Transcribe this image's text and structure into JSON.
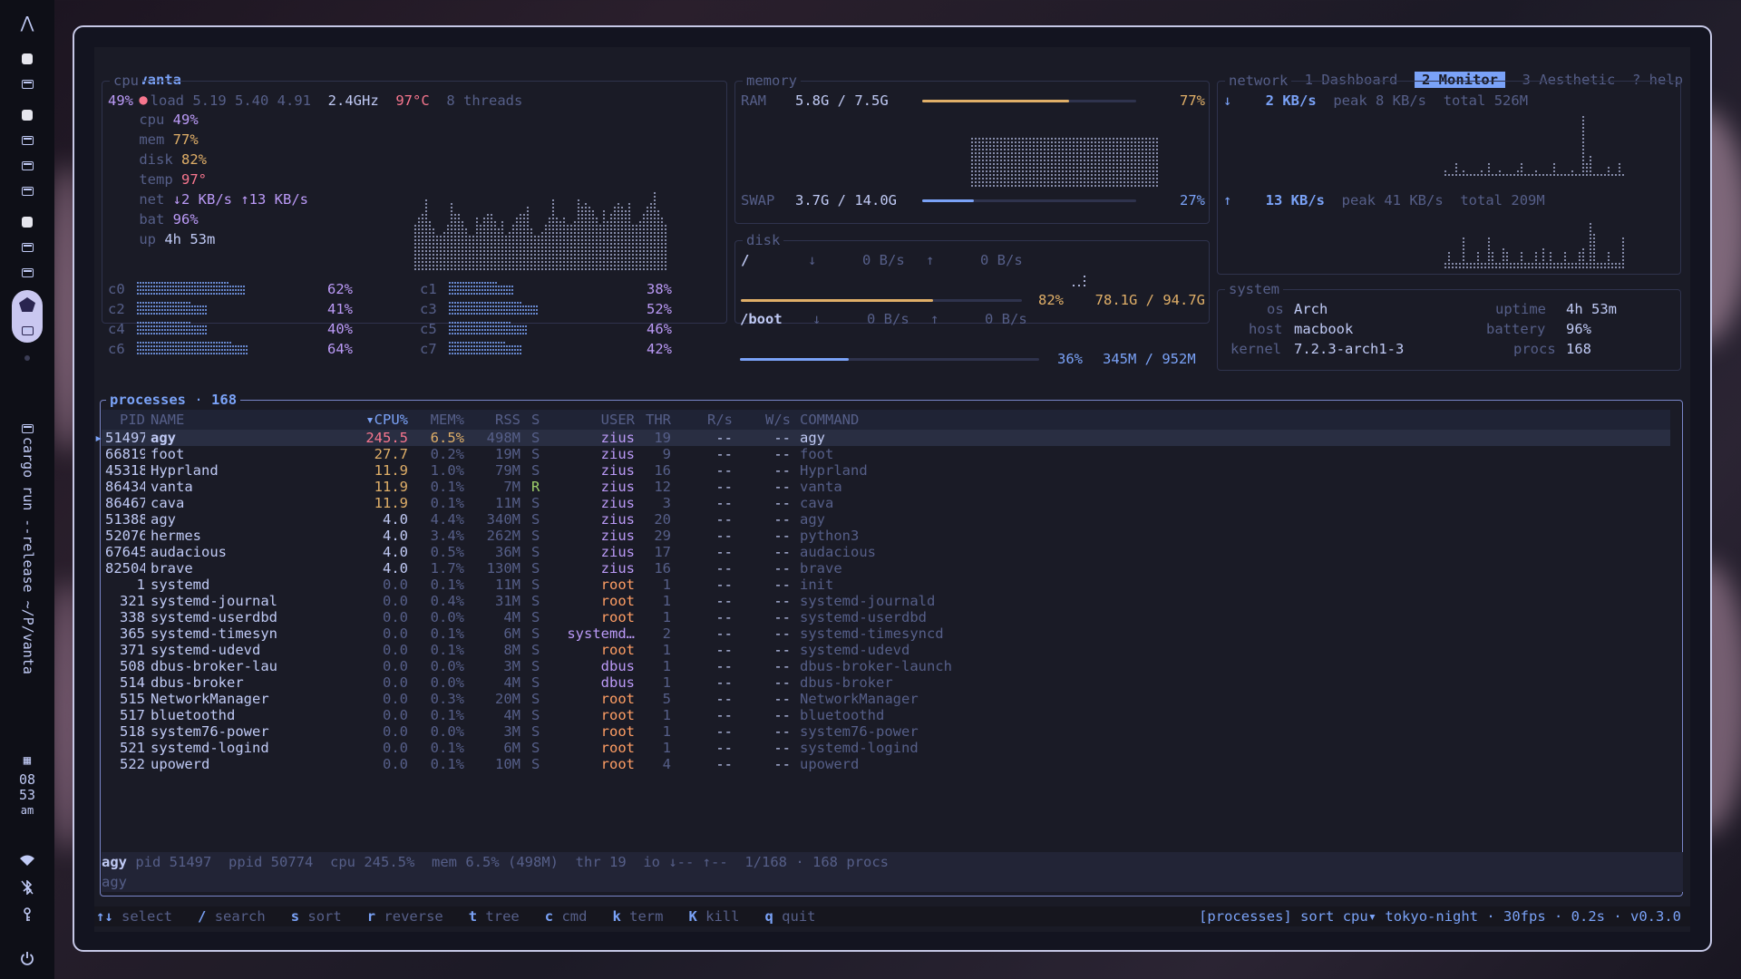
{
  "sidebar": {
    "clock": {
      "hour": "08",
      "minute": "53",
      "ampm": "am"
    },
    "workspace_title": "cargo run --release ~/P/vanta"
  },
  "topbar": {
    "app": "vanta",
    "dot_color": "#f7768e",
    "cpu_label": "cpu",
    "cpu": "49%",
    "mem_label": "mem",
    "mem": "77%",
    "disk_label": "disk",
    "disk": "82%",
    "temp_label": "temp",
    "temp": "97°",
    "net_label": "net",
    "net_down": "↓2 KB/s",
    "net_up": "↑13 KB/s",
    "bat_label": "bat",
    "bat": "96%",
    "up_label": "up",
    "up": "4h 53m",
    "tabs": [
      {
        "label": "1 Dashboard"
      },
      {
        "label": "2 Monitor",
        "active": true
      },
      {
        "label": "3 Aesthetic"
      },
      {
        "label": "? help"
      }
    ]
  },
  "cpu": {
    "title": "cpu",
    "usage": "49%",
    "load_label": "load",
    "load": "5.19 5.40 4.91",
    "freq": "2.4GHz",
    "temp": "97°C",
    "threads": "8 threads",
    "cores": [
      {
        "name": "c0",
        "value": "62%",
        "level": 0.62
      },
      {
        "name": "c1",
        "value": "38%",
        "level": 0.38
      },
      {
        "name": "c2",
        "value": "41%",
        "level": 0.41
      },
      {
        "name": "c3",
        "value": "52%",
        "level": 0.52
      },
      {
        "name": "c4",
        "value": "40%",
        "level": 0.4
      },
      {
        "name": "c5",
        "value": "46%",
        "level": 0.46
      },
      {
        "name": "c6",
        "value": "64%",
        "level": 0.64
      },
      {
        "name": "c7",
        "value": "42%",
        "level": 0.42
      }
    ]
  },
  "memory": {
    "title": "memory",
    "ram_label": "RAM",
    "ram": "5.8G / 7.5G",
    "ram_pct": "77%",
    "ram_level": 0.77,
    "swap_label": "SWAP",
    "swap": "3.7G / 14.0G",
    "swap_pct": "27%",
    "swap_level": 0.27
  },
  "network": {
    "title": "network",
    "down_arrow": "↓",
    "down": "2 KB/s",
    "down_peak_label": "peak",
    "down_peak": "8 KB/s",
    "down_total_label": "total",
    "down_total": "526M",
    "up_arrow": "↑",
    "up": "13 KB/s",
    "up_peak_label": "peak",
    "up_peak": "41 KB/s",
    "up_total_label": "total",
    "up_total": "209M"
  },
  "disk": {
    "title": "disk",
    "mounts": [
      {
        "mount": "/",
        "down": "0 B/s",
        "up": "0 B/s",
        "pct": "82%",
        "usage": "78.1G / 94.7G",
        "level": 0.82
      },
      {
        "mount": "/boot",
        "down": "0 B/s",
        "up": "0 B/s",
        "pct": "36%",
        "usage": "345M / 952M",
        "level": 0.36
      }
    ]
  },
  "system": {
    "title": "system",
    "os_label": "os",
    "os": "Arch",
    "host_label": "host",
    "host": "macbook",
    "kernel_label": "kernel",
    "kernel": "7.2.3-arch1-3",
    "uptime_label": "uptime",
    "uptime": "4h 53m",
    "battery_label": "battery",
    "battery": "96%",
    "procs_label": "procs",
    "procs": "168"
  },
  "processes": {
    "title": "processes",
    "count": "168",
    "headers": {
      "pid": "PID",
      "name": "NAME",
      "cpu": "▾CPU%",
      "mem": "MEM%",
      "rss": "RSS",
      "s": "S",
      "user": "USER",
      "thr": "THR",
      "rs": "R/s",
      "ws": "W/s",
      "cmd": "COMMAND"
    },
    "rows": [
      {
        "pid": "51497",
        "name": "agy",
        "cpu": "245.5",
        "mem": "6.5%",
        "rss": "498M",
        "s": "S",
        "user": "zius",
        "thr": "19",
        "rs": "--",
        "ws": "--",
        "cmd": "agy",
        "selected": true
      },
      {
        "pid": "66819",
        "name": "foot",
        "cpu": "27.7",
        "mem": "0.2%",
        "rss": "19M",
        "s": "S",
        "user": "zius",
        "thr": "9",
        "rs": "--",
        "ws": "--",
        "cmd": "foot"
      },
      {
        "pid": "45318",
        "name": "Hyprland",
        "cpu": "11.9",
        "mem": "1.0%",
        "rss": "79M",
        "s": "S",
        "user": "zius",
        "thr": "16",
        "rs": "--",
        "ws": "--",
        "cmd": "Hyprland"
      },
      {
        "pid": "86434",
        "name": "vanta",
        "cpu": "11.9",
        "mem": "0.1%",
        "rss": "7M",
        "s": "R",
        "user": "zius",
        "thr": "12",
        "rs": "--",
        "ws": "--",
        "cmd": "vanta"
      },
      {
        "pid": "86467",
        "name": "cava",
        "cpu": "11.9",
        "mem": "0.1%",
        "rss": "11M",
        "s": "S",
        "user": "zius",
        "thr": "3",
        "rs": "--",
        "ws": "--",
        "cmd": "cava"
      },
      {
        "pid": "51388",
        "name": "agy",
        "cpu": "4.0",
        "mem": "4.4%",
        "rss": "340M",
        "s": "S",
        "user": "zius",
        "thr": "20",
        "rs": "--",
        "ws": "--",
        "cmd": "agy"
      },
      {
        "pid": "52076",
        "name": "hermes",
        "cpu": "4.0",
        "mem": "3.4%",
        "rss": "262M",
        "s": "S",
        "user": "zius",
        "thr": "29",
        "rs": "--",
        "ws": "--",
        "cmd": "python3"
      },
      {
        "pid": "67645",
        "name": "audacious",
        "cpu": "4.0",
        "mem": "0.5%",
        "rss": "36M",
        "s": "S",
        "user": "zius",
        "thr": "17",
        "rs": "--",
        "ws": "--",
        "cmd": "audacious"
      },
      {
        "pid": "82504",
        "name": "brave",
        "cpu": "4.0",
        "mem": "1.7%",
        "rss": "130M",
        "s": "S",
        "user": "zius",
        "thr": "16",
        "rs": "--",
        "ws": "--",
        "cmd": "brave"
      },
      {
        "pid": "1",
        "name": "systemd",
        "cpu": "0.0",
        "mem": "0.1%",
        "rss": "11M",
        "s": "S",
        "user": "root",
        "thr": "1",
        "rs": "--",
        "ws": "--",
        "cmd": "init"
      },
      {
        "pid": "321",
        "name": "systemd-journal",
        "cpu": "0.0",
        "mem": "0.4%",
        "rss": "31M",
        "s": "S",
        "user": "root",
        "thr": "1",
        "rs": "--",
        "ws": "--",
        "cmd": "systemd-journald"
      },
      {
        "pid": "338",
        "name": "systemd-userdbd",
        "cpu": "0.0",
        "mem": "0.0%",
        "rss": "4M",
        "s": "S",
        "user": "root",
        "thr": "1",
        "rs": "--",
        "ws": "--",
        "cmd": "systemd-userdbd"
      },
      {
        "pid": "365",
        "name": "systemd-timesyn",
        "cpu": "0.0",
        "mem": "0.1%",
        "rss": "6M",
        "s": "S",
        "user": "systemd…",
        "thr": "2",
        "rs": "--",
        "ws": "--",
        "cmd": "systemd-timesyncd"
      },
      {
        "pid": "371",
        "name": "systemd-udevd",
        "cpu": "0.0",
        "mem": "0.1%",
        "rss": "8M",
        "s": "S",
        "user": "root",
        "thr": "1",
        "rs": "--",
        "ws": "--",
        "cmd": "systemd-udevd"
      },
      {
        "pid": "508",
        "name": "dbus-broker-lau",
        "cpu": "0.0",
        "mem": "0.0%",
        "rss": "3M",
        "s": "S",
        "user": "dbus",
        "thr": "1",
        "rs": "--",
        "ws": "--",
        "cmd": "dbus-broker-launch"
      },
      {
        "pid": "514",
        "name": "dbus-broker",
        "cpu": "0.0",
        "mem": "0.0%",
        "rss": "4M",
        "s": "S",
        "user": "dbus",
        "thr": "1",
        "rs": "--",
        "ws": "--",
        "cmd": "dbus-broker"
      },
      {
        "pid": "515",
        "name": "NetworkManager",
        "cpu": "0.0",
        "mem": "0.3%",
        "rss": "20M",
        "s": "S",
        "user": "root",
        "thr": "5",
        "rs": "--",
        "ws": "--",
        "cmd": "NetworkManager"
      },
      {
        "pid": "517",
        "name": "bluetoothd",
        "cpu": "0.0",
        "mem": "0.1%",
        "rss": "4M",
        "s": "S",
        "user": "root",
        "thr": "1",
        "rs": "--",
        "ws": "--",
        "cmd": "bluetoothd"
      },
      {
        "pid": "518",
        "name": "system76-power",
        "cpu": "0.0",
        "mem": "0.0%",
        "rss": "3M",
        "s": "S",
        "user": "root",
        "thr": "1",
        "rs": "--",
        "ws": "--",
        "cmd": "system76-power"
      },
      {
        "pid": "521",
        "name": "systemd-logind",
        "cpu": "0.0",
        "mem": "0.1%",
        "rss": "6M",
        "s": "S",
        "user": "root",
        "thr": "1",
        "rs": "--",
        "ws": "--",
        "cmd": "systemd-logind"
      },
      {
        "pid": "522",
        "name": "upowerd",
        "cpu": "0.0",
        "mem": "0.1%",
        "rss": "10M",
        "s": "S",
        "user": "root",
        "thr": "4",
        "rs": "--",
        "ws": "--",
        "cmd": "upowerd"
      }
    ],
    "status": {
      "name": "agy",
      "pid": "pid 51497",
      "ppid": "ppid 50774",
      "cpu": "cpu 245.5%",
      "mem": "mem 6.5% (498M)",
      "thr": "thr 19",
      "io": "io ↓-- ↑--",
      "pos": "1/168 · 168 procs",
      "cmd": "agy"
    }
  },
  "keybar": {
    "keys": [
      {
        "key": "↑↓",
        "label": "select"
      },
      {
        "key": "/",
        "label": "search"
      },
      {
        "key": "s",
        "label": "sort"
      },
      {
        "key": "r",
        "label": "reverse"
      },
      {
        "key": "t",
        "label": "tree"
      },
      {
        "key": "c",
        "label": "cmd"
      },
      {
        "key": "k",
        "label": "term"
      },
      {
        "key": "K",
        "label": "kill"
      },
      {
        "key": "q",
        "label": "quit"
      }
    ],
    "right": "[processes] sort cpu▾ tokyo-night · 30fps · 0.2s · v0.3.0"
  }
}
